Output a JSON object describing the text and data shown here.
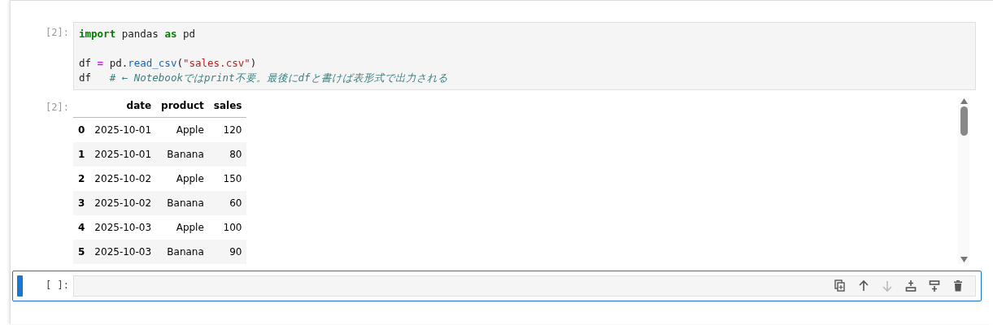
{
  "cells": [
    {
      "prompt": "[2]:",
      "active": false,
      "code": [
        {
          "tokens": [
            {
              "kind": "keyword",
              "text": "import"
            },
            {
              "kind": "plain",
              "text": " pandas "
            },
            {
              "kind": "keyword",
              "text": "as"
            },
            {
              "kind": "plain",
              "text": " pd"
            }
          ]
        },
        {
          "blank_before": true,
          "tokens": [
            {
              "kind": "plain",
              "text": "df "
            },
            {
              "kind": "operator",
              "text": "="
            },
            {
              "kind": "plain",
              "text": " pd."
            },
            {
              "kind": "function",
              "text": "read_csv"
            },
            {
              "kind": "plain",
              "text": "("
            },
            {
              "kind": "string",
              "text": "\"sales.csv\""
            },
            {
              "kind": "plain",
              "text": ")"
            }
          ]
        },
        {
          "tokens": [
            {
              "kind": "plain",
              "text": "df   "
            },
            {
              "kind": "comment",
              "text": "# ← Notebookではprint不要。最後にdfと書けば表形式で出力される"
            }
          ]
        }
      ],
      "output": {
        "prompt": "[2]:",
        "table": {
          "columns": [
            "date",
            "product",
            "sales"
          ],
          "rows": [
            {
              "index": "0",
              "cells": [
                "2025-10-01",
                "Apple",
                "120"
              ]
            },
            {
              "index": "1",
              "cells": [
                "2025-10-01",
                "Banana",
                "80"
              ]
            },
            {
              "index": "2",
              "cells": [
                "2025-10-02",
                "Apple",
                "150"
              ]
            },
            {
              "index": "3",
              "cells": [
                "2025-10-02",
                "Banana",
                "60"
              ]
            },
            {
              "index": "4",
              "cells": [
                "2025-10-03",
                "Apple",
                "100"
              ]
            },
            {
              "index": "5",
              "cells": [
                "2025-10-03",
                "Banana",
                "90"
              ]
            }
          ]
        }
      }
    },
    {
      "prompt": "[ ]:",
      "active": true,
      "toolbar": [
        {
          "kind": "duplicate",
          "disabled": false
        },
        {
          "kind": "move-up",
          "disabled": false
        },
        {
          "kind": "move-down",
          "disabled": true
        },
        {
          "kind": "insert-above",
          "disabled": false
        },
        {
          "kind": "insert-below",
          "disabled": false
        },
        {
          "kind": "delete",
          "disabled": false
        }
      ]
    }
  ]
}
